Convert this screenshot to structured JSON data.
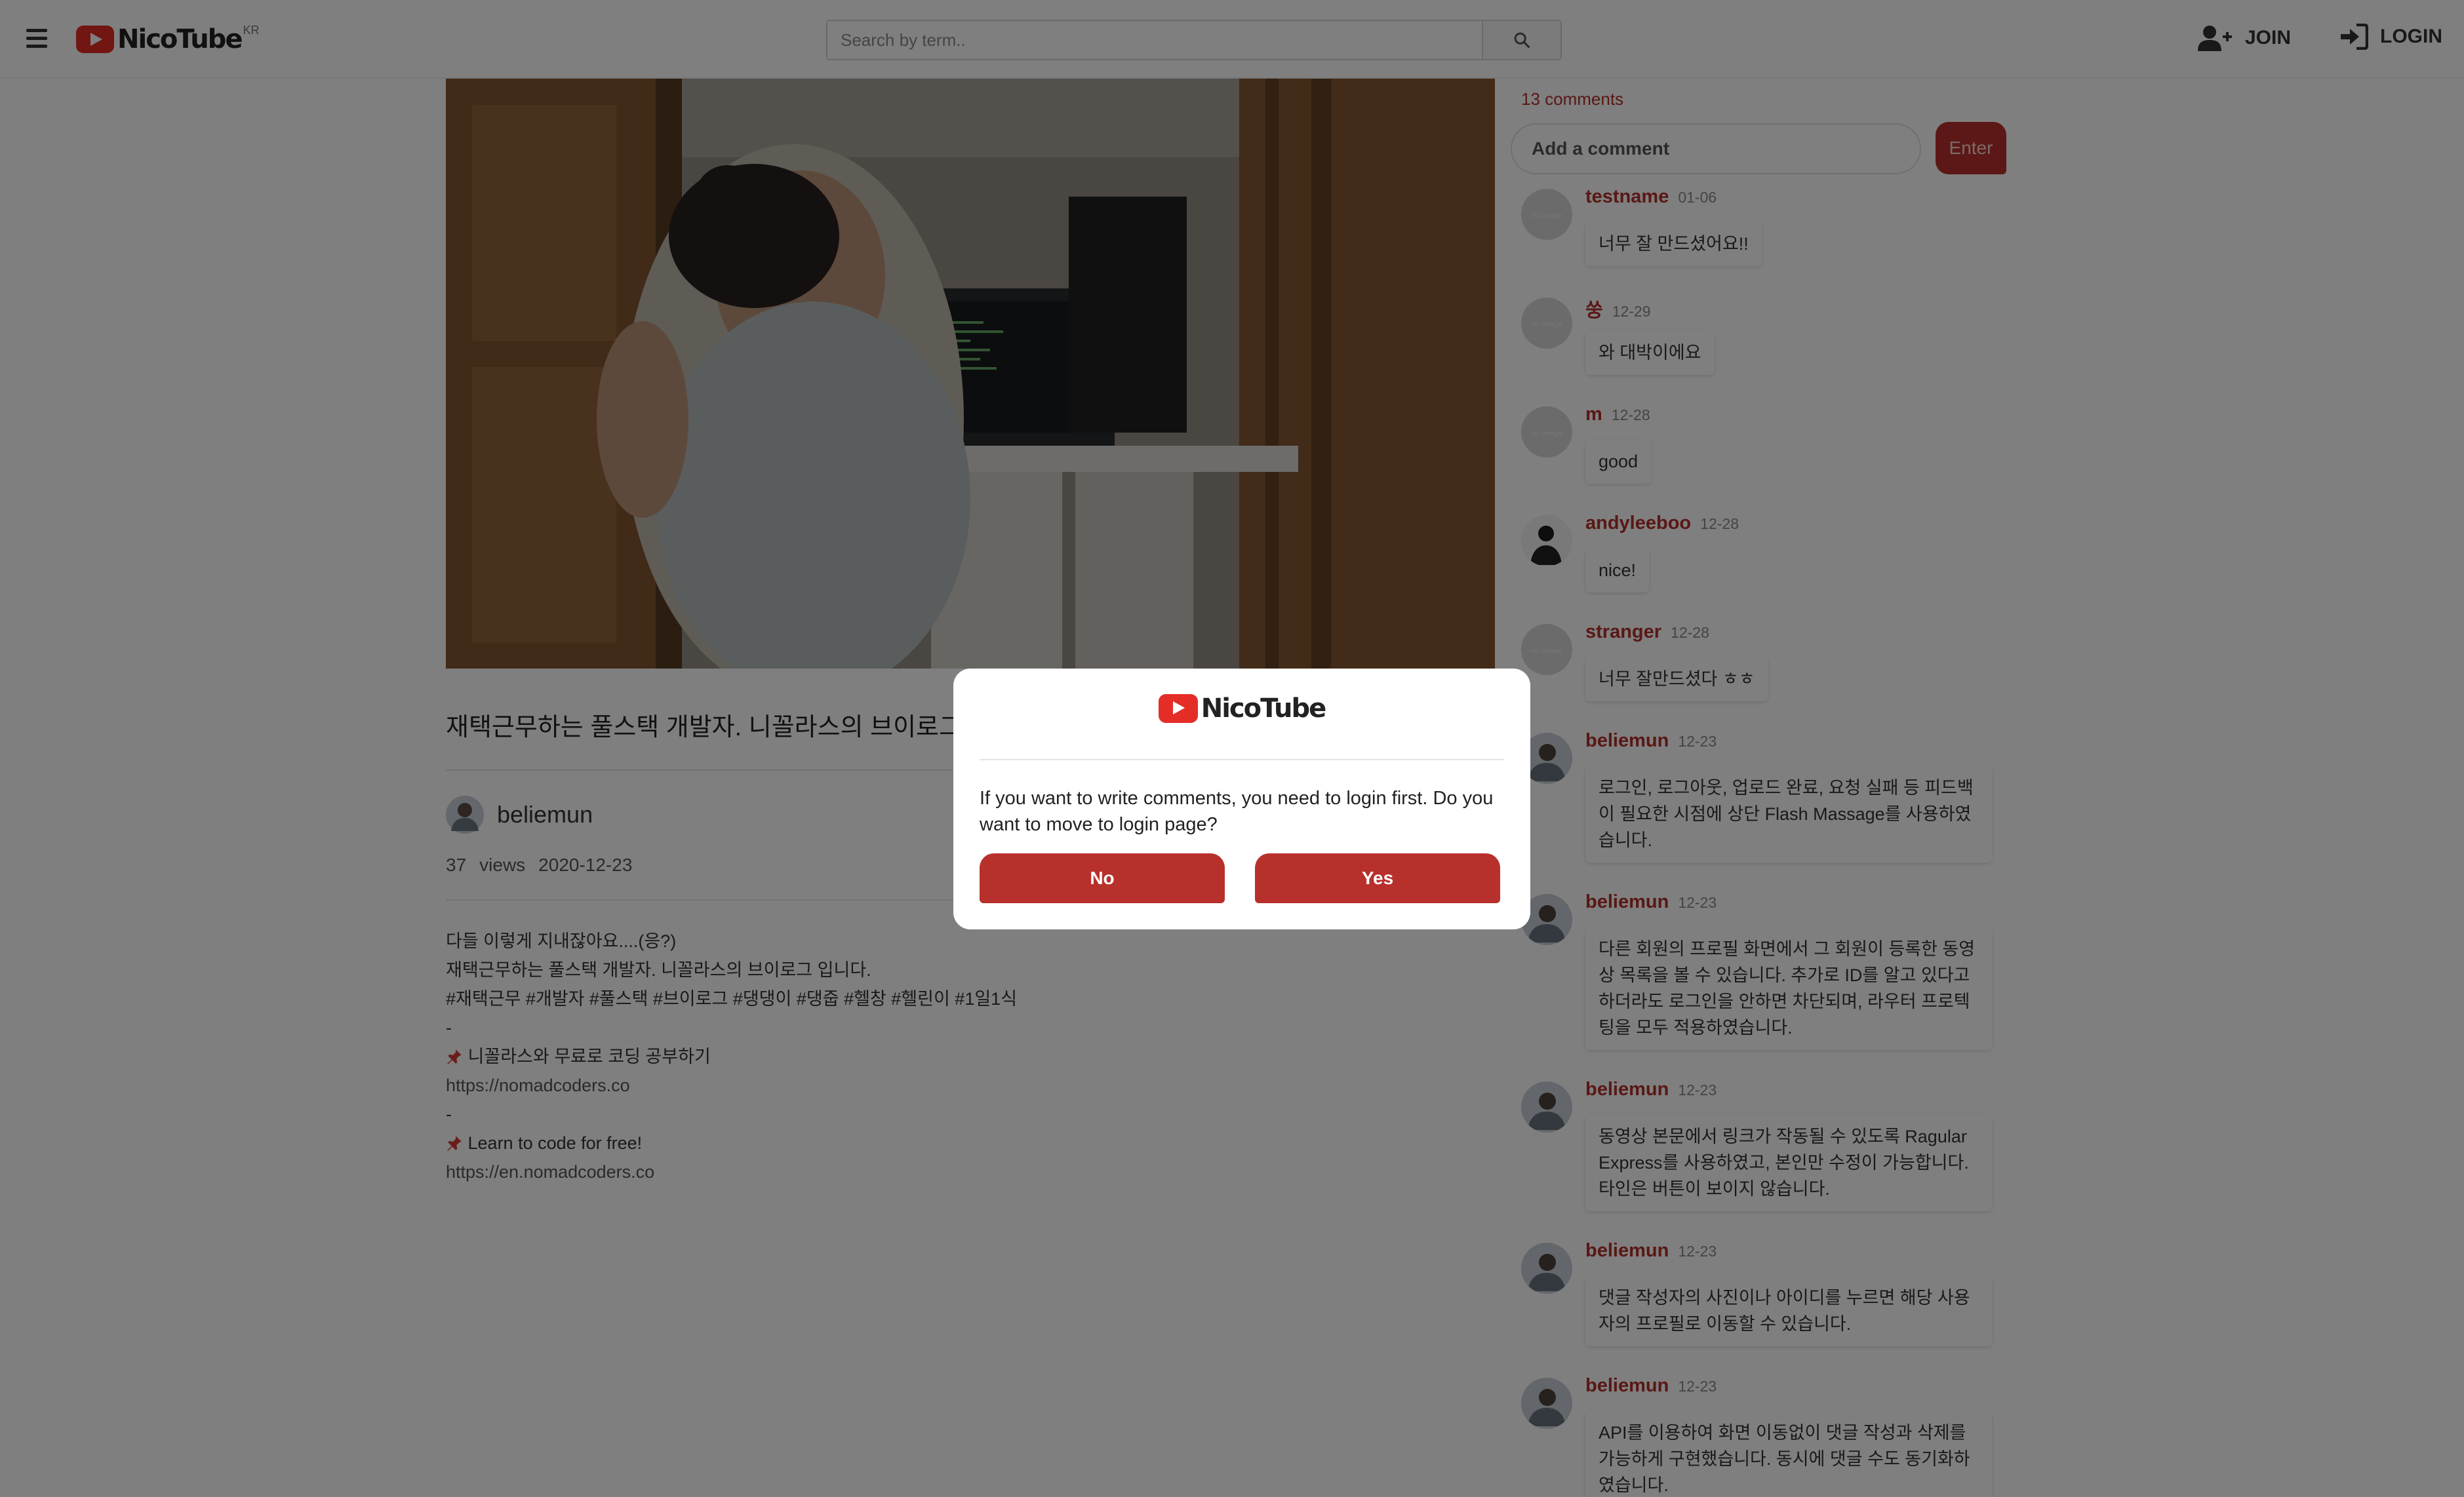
{
  "header": {
    "logo_text": "NicoTube",
    "logo_sup": "KR",
    "search_placeholder": "Search by term..",
    "join_label": "JOIN",
    "login_label": "LOGIN"
  },
  "video": {
    "title": "재택근무하는 풀스택 개발자. 니꼴라스의 브이로그 입니다.",
    "uploader": "beliemun",
    "views": "37",
    "views_label": "views",
    "date": "2020-12-23",
    "description": [
      {
        "text": "다들 이렇게 지내잖아요....(응?)",
        "link": false
      },
      {
        "text": "재택근무하는 풀스택 개발자. 니꼴라스의 브이로그 입니다.",
        "link": false
      },
      {
        "text": "#재택근무 #개발자 #풀스택 #브이로그 #댕댕이 #댕줍 #헬창 #헬린이 #1일1식",
        "link": false
      },
      {
        "text": "-",
        "link": false
      },
      {
        "text": "니꼴라스와 무료로 코딩 공부하기",
        "link": false,
        "pin": true
      },
      {
        "text": "https://nomadcoders.co",
        "link": true
      },
      {
        "text": "-",
        "link": false
      },
      {
        "text": "Learn to code for free!",
        "link": false,
        "pin": true
      },
      {
        "text": "https://en.nomadcoders.co",
        "link": true
      }
    ]
  },
  "comments_panel": {
    "count_label": "13 comments",
    "input_placeholder": "Add a comment",
    "enter_label": "Enter",
    "comments": [
      {
        "user": "testname",
        "date": "01-06",
        "text": "너무 잘 만드셨어요!!",
        "avatar": "default"
      },
      {
        "user": "쑹",
        "date": "12-29",
        "text": "와 대박이에요",
        "avatar": "default"
      },
      {
        "user": "m",
        "date": "12-28",
        "text": "good",
        "avatar": "default"
      },
      {
        "user": "andyleeboo",
        "date": "12-28",
        "text": "nice!",
        "avatar": "photo-dark"
      },
      {
        "user": "stranger",
        "date": "12-28",
        "text": "너무 잘만드셨다 ㅎㅎ",
        "avatar": "default"
      },
      {
        "user": "beliemun",
        "date": "12-23",
        "text": "로그인, 로그아웃, 업로드 완료, 요청 실패 등 피드백이 필요한 시점에 상단 Flash Massage를 사용하였습니다.",
        "avatar": "photo"
      },
      {
        "user": "beliemun",
        "date": "12-23",
        "text": "다른 회원의 프로필 화면에서 그 회원이 등록한 동영상 목록을 볼 수 있습니다. 추가로 ID를 알고 있다고 하더라도 로그인을 안하면 차단되며, 라우터 프로텍팅을 모두 적용하였습니다.",
        "avatar": "photo"
      },
      {
        "user": "beliemun",
        "date": "12-23",
        "text": "동영상 본문에서 링크가 작동될 수 있도록 Ragular Express를 사용하였고, 본인만 수정이 가능합니다. 타인은 버튼이 보이지 않습니다.",
        "avatar": "photo"
      },
      {
        "user": "beliemun",
        "date": "12-23",
        "text": "댓글 작성자의 사진이나 아이디를 누르면 해당 사용자의 프로필로 이동할 수 있습니다.",
        "avatar": "photo"
      },
      {
        "user": "beliemun",
        "date": "12-23",
        "text": "API를 이용하여 화면 이동없이 댓글 작성과 삭제를 가능하게 구현했습니다. 동시에 댓글 수도 동기화하였습니다.",
        "avatar": "photo"
      }
    ]
  },
  "modal": {
    "logo_text": "NicoTube",
    "message": "If you want to write comments, you need to login first. Do you want to move to login page?",
    "no_label": "No",
    "yes_label": "Yes"
  },
  "colors": {
    "accent": "#b8302c",
    "brand_red": "#e52d27",
    "overlay": "rgba(0,0,0,0.5)"
  }
}
